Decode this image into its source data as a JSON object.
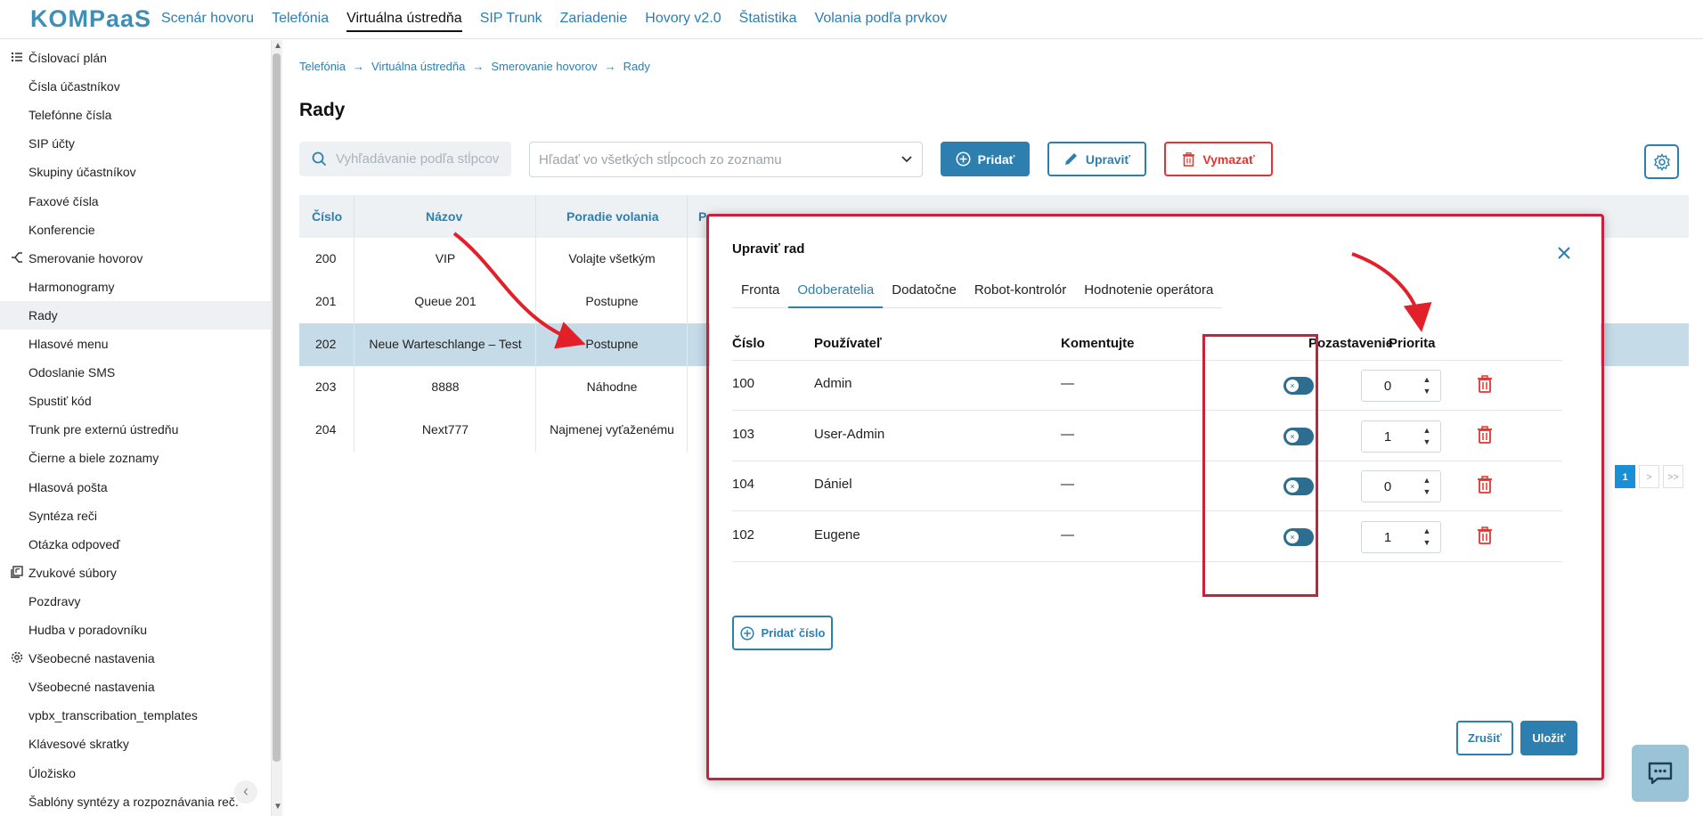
{
  "app": {
    "logo_text": "KOMPaaS",
    "nav": [
      "Scenár hovoru",
      "Telefónia",
      "Virtuálna ústredňa",
      "SIP Trunk",
      "Zariadenie",
      "Hovory v2.0",
      "Štatistika",
      "Volania podľa prvkov"
    ],
    "nav_active": "Virtuálna ústredňa"
  },
  "sidebar": {
    "items": [
      {
        "label": "Číslovací plán",
        "type": "section",
        "icon": "list-icon"
      },
      {
        "label": "Čísla účastníkov",
        "type": "sub"
      },
      {
        "label": "Telefónne čísla",
        "type": "sub"
      },
      {
        "label": "SIP účty",
        "type": "sub"
      },
      {
        "label": "Skupiny účastníkov",
        "type": "sub"
      },
      {
        "label": "Faxové čísla",
        "type": "sub"
      },
      {
        "label": "Konferencie",
        "type": "sub"
      },
      {
        "label": "Smerovanie hovorov",
        "type": "section",
        "icon": "routing-icon"
      },
      {
        "label": "Harmonogramy",
        "type": "sub"
      },
      {
        "label": "Rady",
        "type": "sub",
        "active": true
      },
      {
        "label": "Hlasové menu",
        "type": "sub"
      },
      {
        "label": "Odoslanie SMS",
        "type": "sub"
      },
      {
        "label": "Spustiť kód",
        "type": "sub"
      },
      {
        "label": "Trunk pre externú ústredňu",
        "type": "sub"
      },
      {
        "label": "Čierne a biele zoznamy",
        "type": "sub"
      },
      {
        "label": "Hlasová pošta",
        "type": "sub"
      },
      {
        "label": "Syntéza reči",
        "type": "sub"
      },
      {
        "label": "Otázka odpoveď",
        "type": "sub"
      },
      {
        "label": "Zvukové súbory",
        "type": "section",
        "icon": "audio-files-icon"
      },
      {
        "label": "Pozdravy",
        "type": "sub"
      },
      {
        "label": "Hudba v poradovníku",
        "type": "sub"
      },
      {
        "label": "Všeobecné nastavenia",
        "type": "section",
        "icon": "gear-icon"
      },
      {
        "label": "Všeobecné nastavenia",
        "type": "sub"
      },
      {
        "label": "vpbx_transcribation_templates",
        "type": "sub"
      },
      {
        "label": "Klávesové skratky",
        "type": "sub"
      },
      {
        "label": "Úložisko",
        "type": "sub"
      },
      {
        "label": "Šablóny syntézy a rozpoznávania reč.",
        "type": "sub"
      }
    ]
  },
  "breadcrumb": [
    "Telefónia",
    "Virtuálna ústredňa",
    "Smerovanie hovorov",
    "Rady"
  ],
  "page_title": "Rady",
  "toolbar": {
    "search_placeholder": "Vyhľadávanie podľa stĺpcov",
    "filter_placeholder": "Hľadať vo všetkých stĺpcoch zo zoznamu",
    "add_label": "Pridať",
    "edit_label": "Upraviť",
    "delete_label": "Vymazať"
  },
  "table": {
    "headers": [
      "Číslo",
      "Názov",
      "Poradie volania",
      "P"
    ],
    "rows": [
      {
        "cislo": "200",
        "nazov": "VIP",
        "poradie": "Volajte všetkým"
      },
      {
        "cislo": "201",
        "nazov": "Queue 201",
        "poradie": "Postupne"
      },
      {
        "cislo": "202",
        "nazov": "Neue Warteschlange – Test",
        "poradie": "Postupne",
        "selected": true
      },
      {
        "cislo": "203",
        "nazov": "8888",
        "poradie": "Náhodne"
      },
      {
        "cislo": "204",
        "nazov": "Next777",
        "poradie": "Najmenej vyťaženému"
      }
    ]
  },
  "pagination": {
    "pages": [
      "1",
      ">",
      ">>"
    ],
    "active": "1"
  },
  "modal": {
    "title": "Upraviť rad",
    "tabs": [
      "Fronta",
      "Odoberatelia",
      "Dodatočne",
      "Robot-kontrolór",
      "Hodnotenie operátora"
    ],
    "active_tab": "Odoberatelia",
    "columns": {
      "cislo": "Číslo",
      "pouzivatel": "Používateľ",
      "komentujte": "Komentujte",
      "pozastavenie": "Pozastavenie",
      "priorita": "Priorita"
    },
    "rows": [
      {
        "cislo": "100",
        "pouzivatel": "Admin",
        "komentujte": "—",
        "paused": false,
        "priorita": "0"
      },
      {
        "cislo": "103",
        "pouzivatel": "User-Admin",
        "komentujte": "—",
        "paused": false,
        "priorita": "1"
      },
      {
        "cislo": "104",
        "pouzivatel": "Dániel",
        "komentujte": "—",
        "paused": false,
        "priorita": "0"
      },
      {
        "cislo": "102",
        "pouzivatel": "Eugene",
        "komentujte": "—",
        "paused": false,
        "priorita": "1"
      }
    ],
    "add_number_label": "Pridať číslo",
    "cancel_label": "Zrušiť",
    "save_label": "Uložiť"
  },
  "colors": {
    "accent": "#2d7fb0",
    "danger": "#e3342f",
    "highlight": "#c8213c",
    "selected_row": "#c5dbe8"
  }
}
